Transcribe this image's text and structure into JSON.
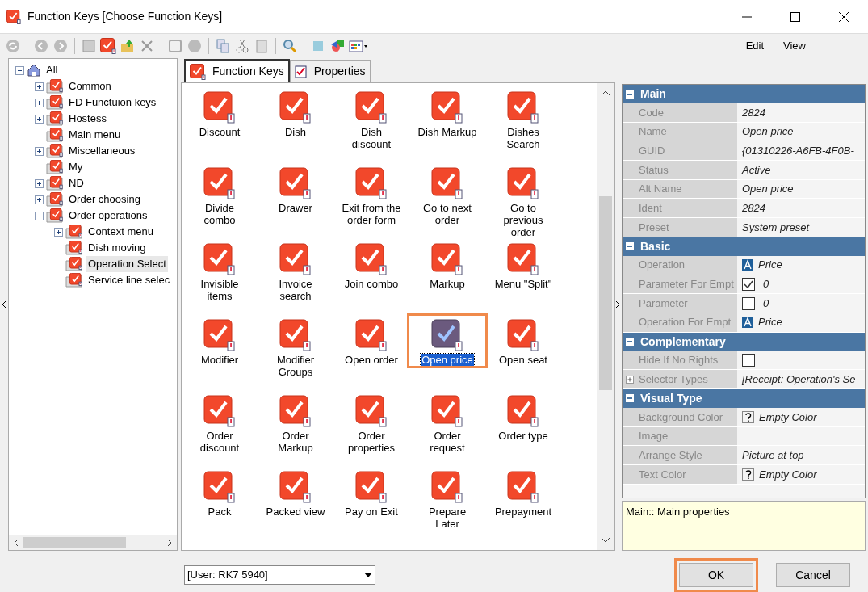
{
  "window": {
    "title": "Function Keys [Choose Function Keys]"
  },
  "menu": [
    "Edit",
    "View"
  ],
  "tree": [
    {
      "label": "All",
      "kind": "root",
      "expanded": true,
      "selected": false,
      "children": [
        {
          "label": "Common",
          "kind": "folder",
          "expanded": false,
          "selected": false
        },
        {
          "label": "FD Functuion keys",
          "kind": "folder",
          "expanded": false,
          "selected": false
        },
        {
          "label": "Hostess",
          "kind": "folder",
          "expanded": false,
          "selected": false
        },
        {
          "label": "Main menu",
          "kind": "folder",
          "selected": false
        },
        {
          "label": "Miscellaneous",
          "kind": "folder",
          "expanded": false,
          "selected": false
        },
        {
          "label": "My",
          "kind": "folder",
          "selected": false
        },
        {
          "label": "ND",
          "kind": "folder",
          "expanded": false,
          "selected": false
        },
        {
          "label": "Order choosing",
          "kind": "folder",
          "expanded": false,
          "selected": false
        },
        {
          "label": "Order operations",
          "kind": "folder",
          "expanded": true,
          "selected": false,
          "children": [
            {
              "label": "Context menu",
              "kind": "folder",
              "expanded": false,
              "selected": false
            },
            {
              "label": "Dish moving",
              "kind": "folder",
              "selected": false
            },
            {
              "label": "Operation Select",
              "kind": "folder",
              "selected": true
            },
            {
              "label": "Service line selec",
              "kind": "folder",
              "selected": false
            }
          ]
        }
      ]
    }
  ],
  "tabs": [
    {
      "label": "Function Keys",
      "selected": true
    },
    {
      "label": "Properties",
      "selected": false
    }
  ],
  "function_keys": [
    {
      "label": "Discount",
      "selected": false,
      "highlighted": false
    },
    {
      "label": "Dish",
      "selected": false,
      "highlighted": false
    },
    {
      "label": "Dish discount",
      "selected": false,
      "highlighted": false
    },
    {
      "label": "Dish Markup",
      "selected": false,
      "highlighted": false
    },
    {
      "label": "Dishes Search",
      "selected": false,
      "highlighted": false
    },
    {
      "label": "Divide combo",
      "selected": false,
      "highlighted": false
    },
    {
      "label": "Drawer",
      "selected": false,
      "highlighted": false
    },
    {
      "label": "Exit from the order form",
      "selected": false,
      "highlighted": false
    },
    {
      "label": "Go to next order",
      "selected": false,
      "highlighted": false
    },
    {
      "label": "Go to previous order",
      "selected": false,
      "highlighted": false
    },
    {
      "label": "Invisible items",
      "selected": false,
      "highlighted": false
    },
    {
      "label": "Invoice search",
      "selected": false,
      "highlighted": false
    },
    {
      "label": "Join combo",
      "selected": false,
      "highlighted": false
    },
    {
      "label": "Markup",
      "selected": false,
      "highlighted": false
    },
    {
      "label": "Menu \"Split\"",
      "selected": false,
      "highlighted": false
    },
    {
      "label": "Modifier",
      "selected": false,
      "highlighted": false
    },
    {
      "label": "Modifier Groups",
      "selected": false,
      "highlighted": false
    },
    {
      "label": "Open order",
      "selected": false,
      "highlighted": false
    },
    {
      "label": "Open price",
      "selected": true,
      "highlighted": true
    },
    {
      "label": "Open seat",
      "selected": false,
      "highlighted": false
    },
    {
      "label": "Order discount",
      "selected": false,
      "highlighted": false
    },
    {
      "label": "Order Markup",
      "selected": false,
      "highlighted": false
    },
    {
      "label": "Order properties",
      "selected": false,
      "highlighted": false
    },
    {
      "label": "Order request",
      "selected": false,
      "highlighted": false
    },
    {
      "label": "Order type",
      "selected": false,
      "highlighted": false
    },
    {
      "label": "Pack",
      "selected": false,
      "highlighted": false
    },
    {
      "label": "Packed view",
      "selected": false,
      "highlighted": false
    },
    {
      "label": "Pay on Exit",
      "selected": false,
      "highlighted": false
    },
    {
      "label": "Prepare Later",
      "selected": false,
      "highlighted": false
    },
    {
      "label": "Prepayment",
      "selected": false,
      "highlighted": false
    }
  ],
  "properties": {
    "sections": [
      {
        "title": "Main",
        "expanded": true,
        "rows": [
          {
            "kind": "text",
            "name": "Code",
            "value": "2824"
          },
          {
            "kind": "text",
            "name": "Name",
            "value": "Open price"
          },
          {
            "kind": "text",
            "name": "GUID",
            "value": "{01310226-A6FB-4F0B-"
          },
          {
            "kind": "text",
            "name": "Status",
            "value": "Active"
          },
          {
            "kind": "text",
            "name": "Alt Name",
            "value": "Open price"
          },
          {
            "kind": "text",
            "name": "Ident",
            "value": "2824"
          },
          {
            "kind": "text",
            "name": "Preset",
            "value": "System preset"
          }
        ]
      },
      {
        "title": "Basic",
        "expanded": true,
        "rows": [
          {
            "kind": "operation",
            "name": "Operation",
            "value": "Price"
          },
          {
            "kind": "check",
            "name": "Parameter For Empt",
            "checked": true,
            "value": "0"
          },
          {
            "kind": "check",
            "name": "Parameter",
            "checked": false,
            "value": "0"
          },
          {
            "kind": "operation",
            "name": "Operation For Empt",
            "value": "Price"
          }
        ]
      },
      {
        "title": "Complementary",
        "expanded": true,
        "rows": [
          {
            "kind": "check",
            "name": "Hide If No Rights",
            "checked": false
          },
          {
            "kind": "text",
            "name": "Selector Types",
            "expanded": false,
            "value": "[Receipt: Operation's Se"
          }
        ]
      },
      {
        "title": "Visual Type",
        "expanded": true,
        "rows": [
          {
            "kind": "color",
            "name": "Background Color",
            "value": "Empty Color"
          },
          {
            "kind": "text",
            "name": "Image"
          },
          {
            "kind": "text",
            "name": "Arrange Style",
            "value": "Picture at top"
          },
          {
            "kind": "color",
            "name": "Text Color",
            "value": "Empty Color"
          }
        ]
      }
    ],
    "description": "Main:: Main properties"
  },
  "user_select": {
    "value": "[User: RK7 5940]"
  },
  "buttons": [
    {
      "label": "OK",
      "highlighted": true
    },
    {
      "label": "Cancel",
      "highlighted": false
    }
  ]
}
